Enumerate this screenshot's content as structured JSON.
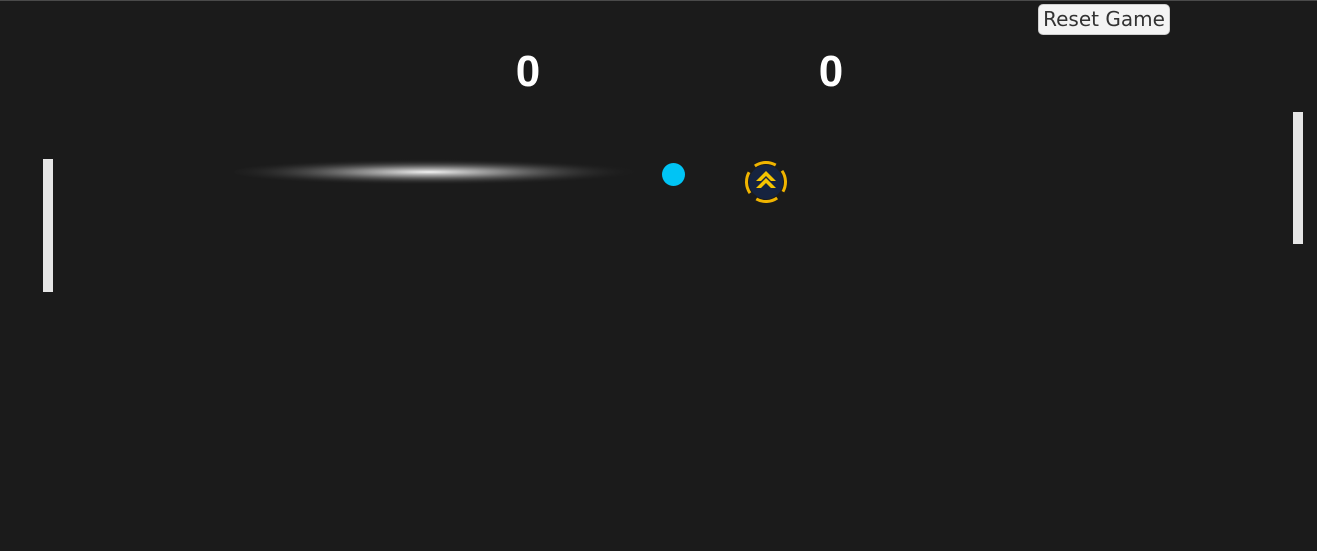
{
  "controls": {
    "reset_label": "Reset Game"
  },
  "scores": {
    "left": "0",
    "right": "0"
  },
  "colors": {
    "background": "#1b1b1b",
    "ball": "#00c4f5",
    "paddle": "#e6e6e6",
    "score": "#ffffff",
    "powerup_ring": "#f0b400",
    "powerup_core": "#16233f"
  },
  "powerup": {
    "icon": "chevron-up-icon"
  }
}
